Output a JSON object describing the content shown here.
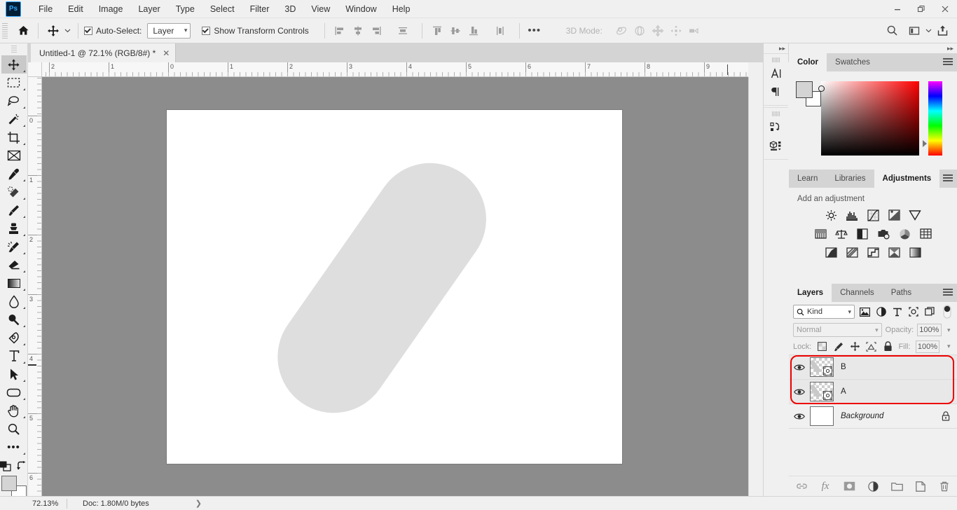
{
  "app": {
    "name": "Ps",
    "window_controls": [
      "minimize",
      "restore",
      "close"
    ]
  },
  "menubar": {
    "items": [
      "File",
      "Edit",
      "Image",
      "Layer",
      "Type",
      "Select",
      "Filter",
      "3D",
      "View",
      "Window",
      "Help"
    ]
  },
  "options_bar": {
    "home_icon": "home-icon",
    "tool_icon": "move-tool-icon",
    "auto_select_label": "Auto-Select:",
    "auto_select_checked": true,
    "layer_select_value": "Layer",
    "show_transform_label": "Show Transform Controls",
    "show_transform_checked": true,
    "align_icons": [
      "align-left-edges",
      "align-horizontal-centers",
      "align-right-edges",
      "distribute-horizontally"
    ],
    "align_icons2": [
      "align-top-edges",
      "align-vertical-centers",
      "align-bottom-edges",
      "distribute-vertically"
    ],
    "more_label": "•••",
    "mode_3d_label": "3D Mode:",
    "mode_3d_icons": [
      "orbit-3d",
      "roll-3d",
      "pan-3d",
      "slide-3d",
      "camera-3d"
    ],
    "right_icons": [
      "search-icon",
      "workspace-icon",
      "chevron-down-icon",
      "share-icon"
    ]
  },
  "document": {
    "tab_title": "Untitled-1 @ 72.1% (RGB/8#) *",
    "close_label": "✕"
  },
  "toolbar": {
    "tools": [
      {
        "name": "move-tool",
        "active": true
      },
      {
        "name": "rectangular-marquee-tool",
        "active": false
      },
      {
        "name": "lasso-tool",
        "active": false
      },
      {
        "name": "magic-wand-tool",
        "active": false
      },
      {
        "name": "crop-tool",
        "active": false
      },
      {
        "name": "frame-tool",
        "active": false
      },
      {
        "name": "eyedropper-tool",
        "active": false
      },
      {
        "name": "spot-healing-brush-tool",
        "active": false
      },
      {
        "name": "brush-tool",
        "active": false
      },
      {
        "name": "clone-stamp-tool",
        "active": false
      },
      {
        "name": "history-brush-tool",
        "active": false
      },
      {
        "name": "eraser-tool",
        "active": false
      },
      {
        "name": "gradient-tool",
        "active": false
      },
      {
        "name": "blur-tool",
        "active": false
      },
      {
        "name": "dodge-tool",
        "active": false
      },
      {
        "name": "pen-tool",
        "active": false
      },
      {
        "name": "type-tool",
        "active": false
      },
      {
        "name": "path-selection-tool",
        "active": false
      },
      {
        "name": "rectangle-tool",
        "active": false
      },
      {
        "name": "hand-tool",
        "active": false
      },
      {
        "name": "zoom-tool",
        "active": false
      },
      {
        "name": "edit-toolbar",
        "active": false
      }
    ],
    "foreground_color": "#d4d4d4",
    "background_color": "#ffffff"
  },
  "rulers": {
    "unit_hint": "inches",
    "horizontal_ticks": [
      "2",
      "1",
      "0",
      "1",
      "2",
      "3",
      "4",
      "5",
      "6",
      "7",
      "8",
      "9"
    ],
    "vertical_ticks": [
      "0",
      "1",
      "2",
      "3",
      "4",
      "5",
      "6"
    ]
  },
  "canvas": {
    "background_color": "#8c8c8c",
    "artboard_color": "#ffffff",
    "shape": {
      "name": "rounded-capsule-shape",
      "fill": "#dedede",
      "rotation_deg": 35
    }
  },
  "rail": {
    "collapse_label": "▸▸",
    "icons": [
      "character-panel-icon",
      "paragraph-panel-icon",
      "actions-panel-icon",
      "3d-panel-icon"
    ]
  },
  "color_panel": {
    "collapse_label": "▸▸",
    "tabs": [
      {
        "label": "Color",
        "active": true
      },
      {
        "label": "Swatches",
        "active": false
      }
    ],
    "foreground": "#d4d4d4",
    "background": "#ffffff",
    "menu_icon": "panel-menu-icon"
  },
  "adjustments_panel": {
    "tabs": [
      {
        "label": "Learn",
        "active": false
      },
      {
        "label": "Libraries",
        "active": false
      },
      {
        "label": "Adjustments",
        "active": true
      }
    ],
    "title": "Add an adjustment",
    "row1": [
      "brightness-contrast-icon",
      "levels-icon",
      "curves-icon",
      "exposure-icon",
      "vibrance-icon"
    ],
    "row2": [
      "hue-saturation-icon",
      "color-balance-icon",
      "black-white-icon",
      "photo-filter-icon",
      "channel-mixer-icon",
      "color-lookup-icon"
    ],
    "row3": [
      "invert-icon",
      "posterize-icon",
      "threshold-icon",
      "selective-color-icon",
      "gradient-map-icon"
    ],
    "menu_icon": "panel-menu-icon"
  },
  "layers_panel": {
    "tabs": [
      {
        "label": "Layers",
        "active": true
      },
      {
        "label": "Channels",
        "active": false
      },
      {
        "label": "Paths",
        "active": false
      }
    ],
    "menu_icon": "panel-menu-icon",
    "filter": {
      "kind_label": "Kind",
      "search_icon": "search-icon",
      "filter_icons": [
        "filter-pixel-icon",
        "filter-adjustment-icon",
        "filter-type-icon",
        "filter-shape-icon",
        "filter-smart-object-icon"
      ],
      "toggle_icon": "filter-toggle"
    },
    "blend_mode": "Normal",
    "opacity_label": "Opacity:",
    "opacity_value": "100%",
    "lock_label": "Lock:",
    "lock_icons": [
      "lock-transparent-pixels-icon",
      "lock-image-pixels-icon",
      "lock-position-icon",
      "lock-artboard-nesting-icon",
      "lock-all-icon"
    ],
    "fill_label": "Fill:",
    "fill_value": "100%",
    "selection_highlight_color": "#ee0000",
    "layers": [
      {
        "name": "B",
        "visible": true,
        "selected": true,
        "locked": false,
        "type": "shape"
      },
      {
        "name": "A",
        "visible": true,
        "selected": true,
        "locked": false,
        "type": "shape"
      },
      {
        "name": "Background",
        "visible": true,
        "selected": false,
        "locked": true,
        "type": "background"
      }
    ],
    "footer_icons": [
      "link-layers-icon",
      "layer-style-icon",
      "layer-mask-icon",
      "new-fill-adjustment-icon",
      "new-group-icon",
      "new-layer-icon",
      "delete-layer-icon"
    ]
  },
  "status_bar": {
    "zoom": "72.13%",
    "doc_info": "Doc: 1.80M/0 bytes",
    "expand_icon": "chevron-right-icon"
  }
}
